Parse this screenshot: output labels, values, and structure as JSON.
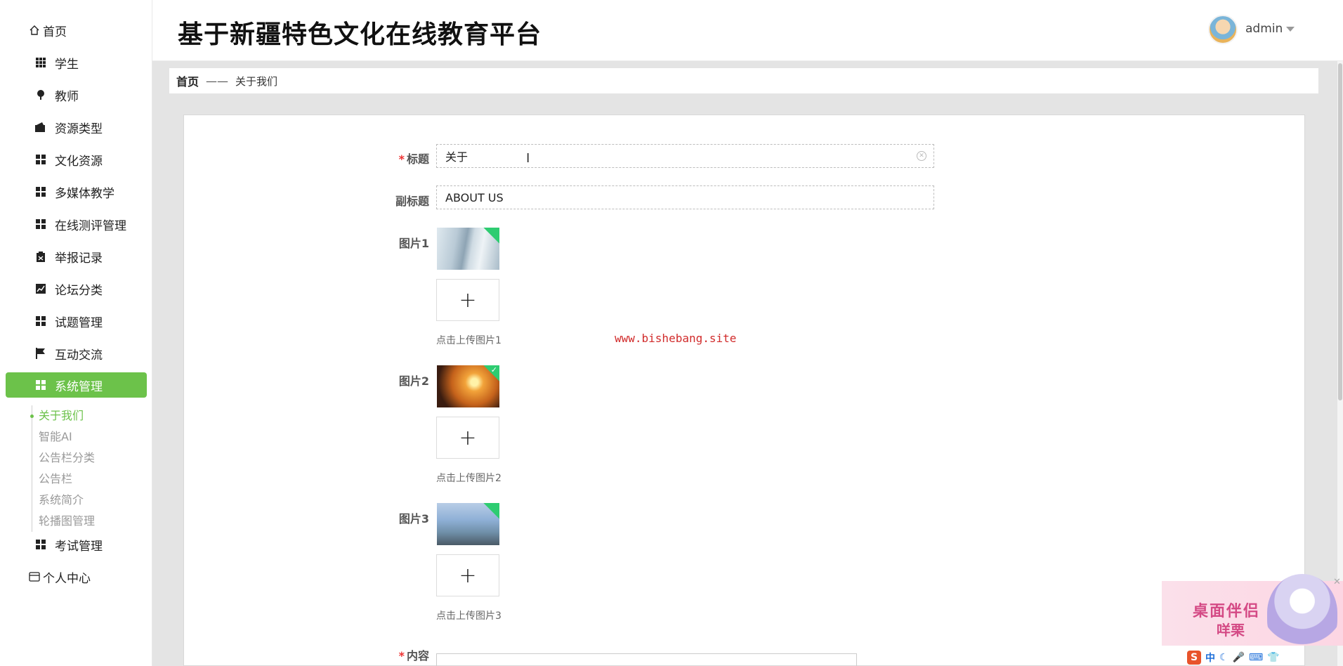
{
  "app": {
    "title": "基于新疆特色文化在线教育平台",
    "username": "admin"
  },
  "sidebar": {
    "items": [
      {
        "label": "首页",
        "icon": "home-icon"
      },
      {
        "label": "学生",
        "icon": "grid-icon"
      },
      {
        "label": "教师",
        "icon": "pin-icon"
      },
      {
        "label": "资源类型",
        "icon": "wallet-icon"
      },
      {
        "label": "文化资源",
        "icon": "apps-icon"
      },
      {
        "label": "多媒体教学",
        "icon": "apps-icon"
      },
      {
        "label": "在线测评管理",
        "icon": "apps-icon"
      },
      {
        "label": "举报记录",
        "icon": "clipboard-icon"
      },
      {
        "label": "论坛分类",
        "icon": "chart-icon"
      },
      {
        "label": "试题管理",
        "icon": "apps-icon"
      },
      {
        "label": "互动交流",
        "icon": "flag-icon"
      },
      {
        "label": "系统管理",
        "icon": "apps-icon"
      },
      {
        "label": "考试管理",
        "icon": "apps-icon"
      },
      {
        "label": "个人中心",
        "icon": "card-icon"
      }
    ],
    "sub_items": [
      "关于我们",
      "智能AI",
      "公告栏分类",
      "公告栏",
      "系统简介",
      "轮播图管理"
    ],
    "active_color": "#6cc24a"
  },
  "breadcrumb": {
    "home": "首页",
    "separator": "——",
    "current": "关于我们"
  },
  "form": {
    "title_label": "标题",
    "title_value": "关于",
    "subtitle_label": "副标题",
    "subtitle_value": "ABOUT US",
    "image1_label": "图片1",
    "image1_hint": "点击上传图片1",
    "image2_label": "图片2",
    "image2_hint": "点击上传图片2",
    "image3_label": "图片3",
    "image3_hint": "点击上传图片3",
    "content_label": "内容",
    "required_mark": "*",
    "upload_plus": "+"
  },
  "watermark": "www.bishebang.site",
  "pet_widget": {
    "line1": "桌面伴侣",
    "line2": "咩栗"
  },
  "ime": {
    "logo": "S",
    "mode": "中"
  }
}
